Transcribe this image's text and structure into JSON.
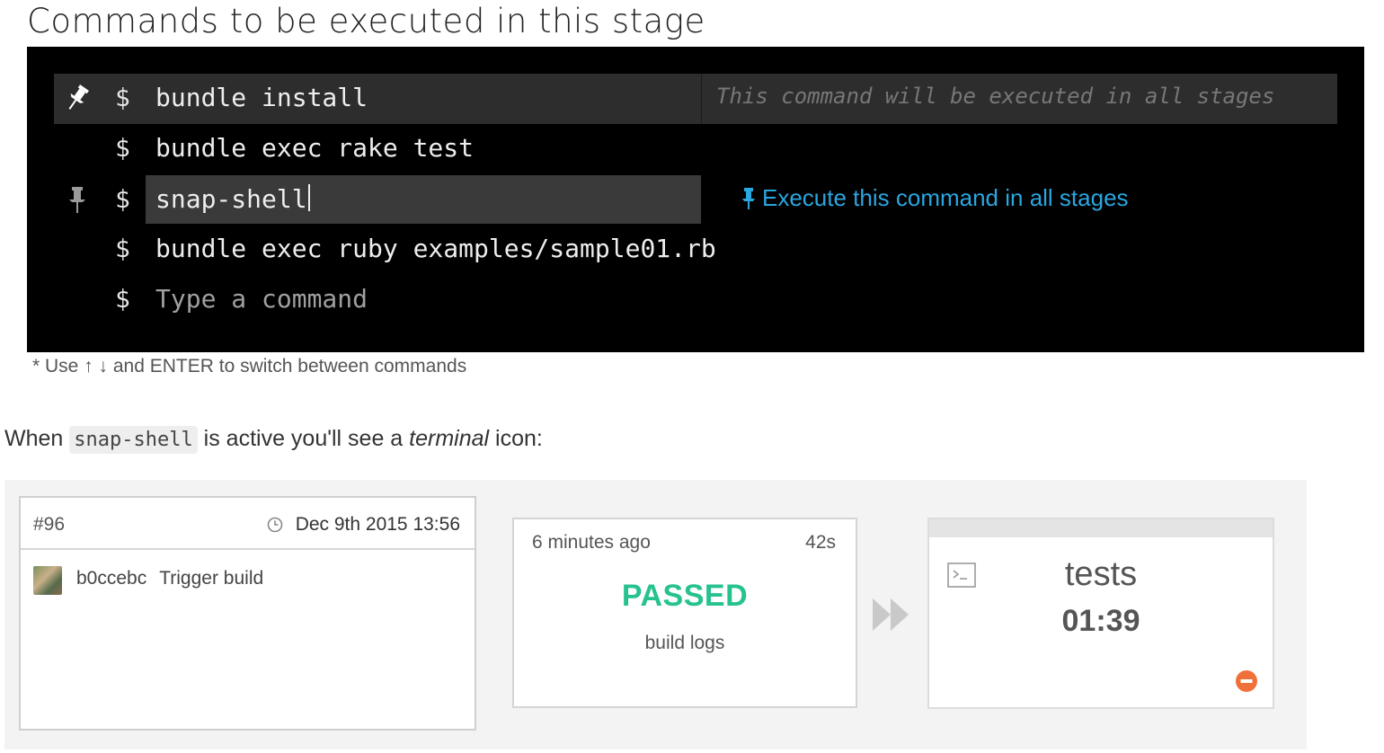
{
  "heading": "Commands to be executed in this stage",
  "terminal": {
    "prompt": "$",
    "commands": [
      {
        "text": "bundle install",
        "pinned": true
      },
      {
        "text": "bundle exec rake test",
        "pinned": false
      },
      {
        "text": "snap-shell",
        "pinned": false,
        "editing": true
      },
      {
        "text": "bundle exec ruby examples/sample01.rb",
        "pinned": false
      }
    ],
    "all_stages_note": "This command will be executed in all stages",
    "execute_all_label": "Execute this command in all stages",
    "placeholder": "Type a command"
  },
  "hint": "* Use ↑ ↓ and ENTER to switch between commands",
  "paragraph": {
    "before": "When ",
    "code": "snap-shell",
    "middle": " is active you'll see a ",
    "emphasis": "terminal",
    "after": " icon:"
  },
  "build": {
    "number": "#96",
    "date": "Dec 9th 2015 13:56",
    "commit_sha": "b0ccebc",
    "commit_message": "Trigger build"
  },
  "stage": {
    "time_ago": "6 minutes ago",
    "duration": "42s",
    "status": "PASSED",
    "logs_link": "build logs"
  },
  "tests_stage": {
    "name": "tests",
    "elapsed": "01:39"
  },
  "colors": {
    "passed": "#26c28f",
    "link": "#2aa6e0",
    "stop": "#f0703a"
  }
}
